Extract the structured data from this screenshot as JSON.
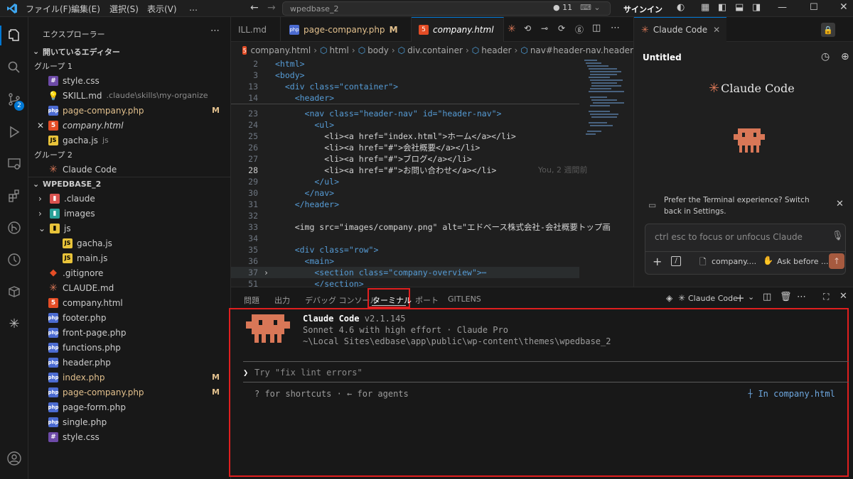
{
  "titlebar": {
    "menus": [
      "ファイル(F)",
      "編集(E)",
      "選択(S)",
      "表示(V)",
      "…"
    ],
    "search_text": "wpedbase_2",
    "changes_count": "11",
    "signin": "サインイン"
  },
  "activity": {
    "scm_badge": "2",
    "icons": [
      "files-icon",
      "search-icon",
      "source-control-icon",
      "run-debug-icon",
      "remote-explorer-icon",
      "extensions-icon",
      "gitlens-icon",
      "timeline-icon",
      "containers-icon",
      "claude-icon",
      "account-icon"
    ]
  },
  "sidebar": {
    "title": "エクスプローラー",
    "open_editors": "開いているエディター",
    "group1": "グループ 1",
    "group2": "グループ 2",
    "open_items": [
      {
        "name": "style.css",
        "desc": "",
        "icon": "css-icon"
      },
      {
        "name": "SKILL.md",
        "desc": ".claude\\skills\\my-organize",
        "icon": "lightbulb-icon"
      },
      {
        "name": "page-company.php",
        "desc": "",
        "badge": "M",
        "icon": "php-icon"
      },
      {
        "name": "company.html",
        "desc": "",
        "icon": "html-icon"
      },
      {
        "name": "gacha.js",
        "desc": "js",
        "icon": "js-icon"
      }
    ],
    "group2_item": "Claude Code",
    "workspace": "WPEDBASE_2",
    "tree": [
      {
        "name": ".claude",
        "type": "folder"
      },
      {
        "name": "images",
        "type": "folder"
      },
      {
        "name": "js",
        "type": "folder-open"
      },
      {
        "name": "gacha.js",
        "type": "js"
      },
      {
        "name": "main.js",
        "type": "js"
      },
      {
        "name": ".gitignore",
        "type": "git"
      },
      {
        "name": "CLAUDE.md",
        "type": "claude"
      },
      {
        "name": "company.html",
        "type": "html"
      },
      {
        "name": "footer.php",
        "type": "php"
      },
      {
        "name": "front-page.php",
        "type": "php"
      },
      {
        "name": "functions.php",
        "type": "php"
      },
      {
        "name": "header.php",
        "type": "php"
      },
      {
        "name": "index.php",
        "type": "php",
        "badge": "M"
      },
      {
        "name": "page-company.php",
        "type": "php",
        "badge": "M"
      },
      {
        "name": "page-form.php",
        "type": "php"
      },
      {
        "name": "single.php",
        "type": "php"
      },
      {
        "name": "style.css",
        "type": "css"
      }
    ]
  },
  "editor": {
    "tabs": [
      {
        "label": "ILL.md"
      },
      {
        "label": "page-company.php",
        "badge": "M"
      },
      {
        "label": "company.html"
      }
    ],
    "breadcrumb": [
      "company.html",
      "html",
      "body",
      "div.container",
      "header",
      "nav#header-nav.header"
    ],
    "lines": [
      {
        "n": "2",
        "c": "<html>"
      },
      {
        "n": "3",
        "c": "<body>"
      },
      {
        "n": "13",
        "c": "  <div class=\"container\">"
      },
      {
        "n": "14",
        "c": "    <header>"
      },
      {
        "n": "23",
        "c": "      <nav class=\"header-nav\" id=\"header-nav\">"
      },
      {
        "n": "24",
        "c": "        <ul>"
      },
      {
        "n": "25",
        "c": "          <li><a href=\"index.html\">ホーム</a></li>"
      },
      {
        "n": "26",
        "c": "          <li><a href=\"#\">会社概要</a></li>"
      },
      {
        "n": "27",
        "c": "          <li><a href=\"#\">ブログ</a></li>"
      },
      {
        "n": "28",
        "c": "          <li><a href=\"#\">お問い合わせ</a></li>"
      },
      {
        "n": "29",
        "c": "        </ul>"
      },
      {
        "n": "30",
        "c": "      </nav>"
      },
      {
        "n": "31",
        "c": "    </header>"
      },
      {
        "n": "32",
        "c": ""
      },
      {
        "n": "33",
        "c": "    <img src=\"images/company.png\" alt=\"エドベース株式会社-会社概要トップ画"
      },
      {
        "n": "34",
        "c": ""
      },
      {
        "n": "35",
        "c": "    <div class=\"row\">"
      },
      {
        "n": "36",
        "c": "      <main>"
      },
      {
        "n": "37",
        "c": "        <section class=\"company-overview\">⋯"
      },
      {
        "n": "51",
        "c": "        </section>"
      }
    ],
    "blame": "You, 2 週間前"
  },
  "claude_panel": {
    "tab": "Claude Code",
    "session": "Untitled",
    "logo_text": "Claude Code",
    "notice": "Prefer the Terminal experience? Switch back in Settings.",
    "input_placeholder": "ctrl esc to focus or unfocus Claude",
    "file_chip": "company....",
    "mode_chip": "Ask before ..."
  },
  "panel": {
    "tabs": [
      "問題",
      "出力",
      "デバッグ コンソール",
      "ターミナル",
      "ポート",
      "GITLENS"
    ],
    "active_tab": "ターミナル",
    "terminal_name": "Claude Code",
    "term": {
      "title": "Claude Code",
      "version": "v2.1.145",
      "model": "Sonnet 4.6 with high effort · Claude Pro",
      "path": "~\\Local Sites\\edbase\\app\\public\\wp-content\\themes\\wpedbase_2",
      "prompt": "Try \"fix lint errors\"",
      "hint": "? for shortcuts · ← for agents",
      "context": "In company.html"
    }
  },
  "colors": {
    "accent": "#0078d4",
    "highlight": "#e01f1f",
    "claude": "#d97757",
    "modified": "#e2c08d"
  }
}
